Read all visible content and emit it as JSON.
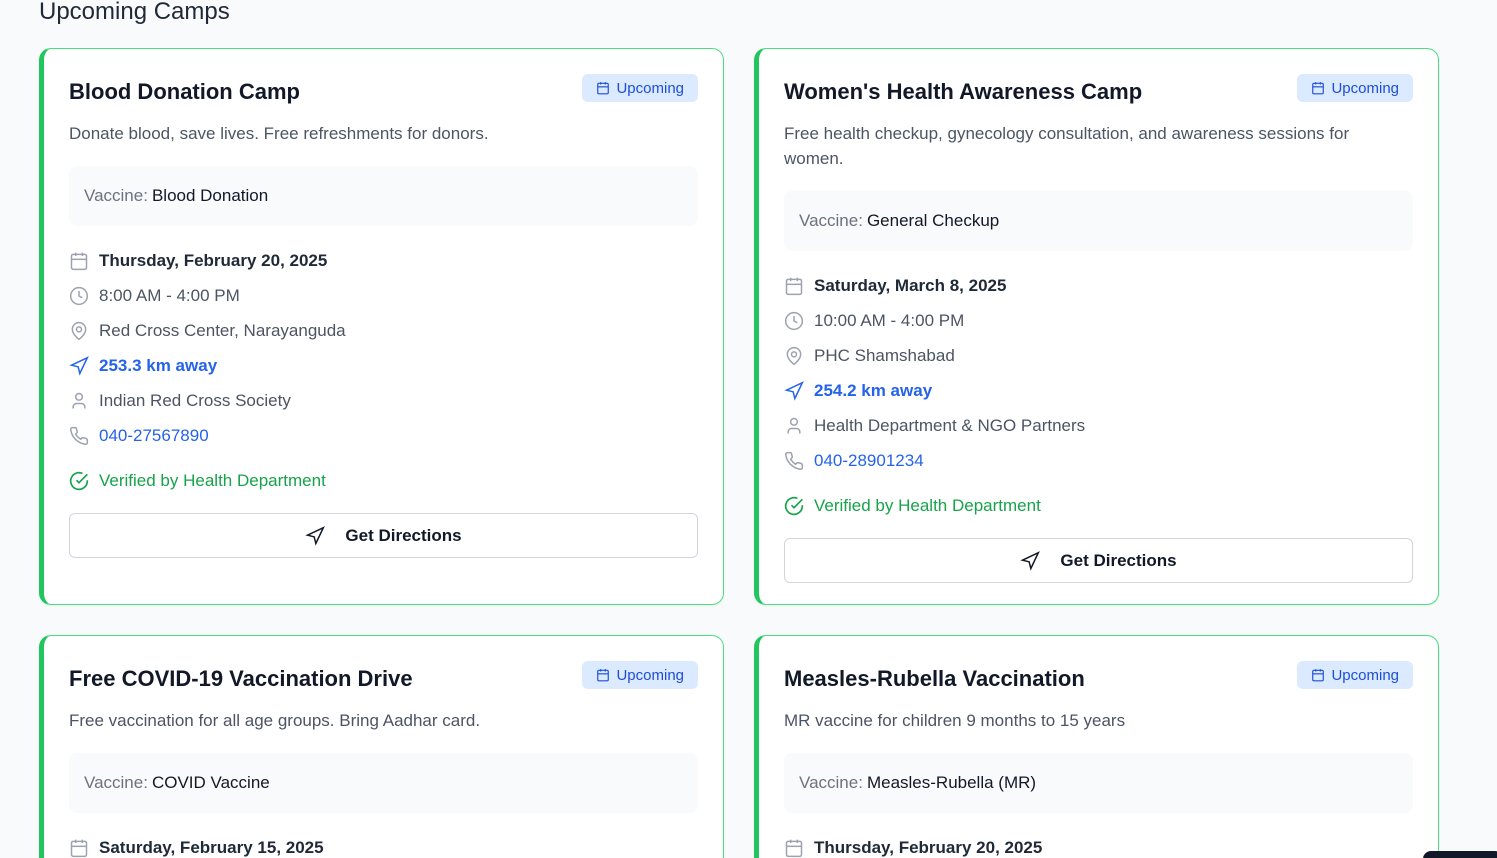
{
  "section": {
    "title": "Upcoming Camps"
  },
  "labels": {
    "vaccine_prefix": "Vaccine:",
    "directions": "Get Directions",
    "verified": "Verified by Health Department"
  },
  "camps": [
    {
      "title": "Blood Donation Camp",
      "status": "Upcoming",
      "description": "Donate blood, save lives. Free refreshments for donors.",
      "vaccine": "Blood Donation",
      "date": "Thursday, February 20, 2025",
      "time": "8:00 AM - 4:00 PM",
      "location": "Red Cross Center, Narayanguda",
      "distance": "253.3 km away",
      "organizer": "Indian Red Cross Society",
      "phone": "040-27567890"
    },
    {
      "title": "Women's Health Awareness Camp",
      "status": "Upcoming",
      "description": "Free health checkup, gynecology consultation, and awareness sessions for women.",
      "vaccine": "General Checkup",
      "date": "Saturday, March 8, 2025",
      "time": "10:00 AM - 4:00 PM",
      "location": "PHC Shamshabad",
      "distance": "254.2 km away",
      "organizer": "Health Department & NGO Partners",
      "phone": "040-28901234"
    },
    {
      "title": "Free COVID-19 Vaccination Drive",
      "status": "Upcoming",
      "description": "Free vaccination for all age groups. Bring Aadhar card.",
      "vaccine": "COVID Vaccine",
      "date": "Saturday, February 15, 2025"
    },
    {
      "title": "Measles-Rubella Vaccination",
      "status": "Upcoming",
      "description": "MR vaccine for children 9 months to 15 years",
      "vaccine": "Measles-Rubella (MR)",
      "date": "Thursday, February 20, 2025"
    }
  ],
  "colors": {
    "accent_green": "#22c55e",
    "badge_bg": "#dbeafe",
    "badge_text": "#1d4ed8",
    "link_blue": "#2563eb",
    "verified_green": "#16a34a"
  }
}
